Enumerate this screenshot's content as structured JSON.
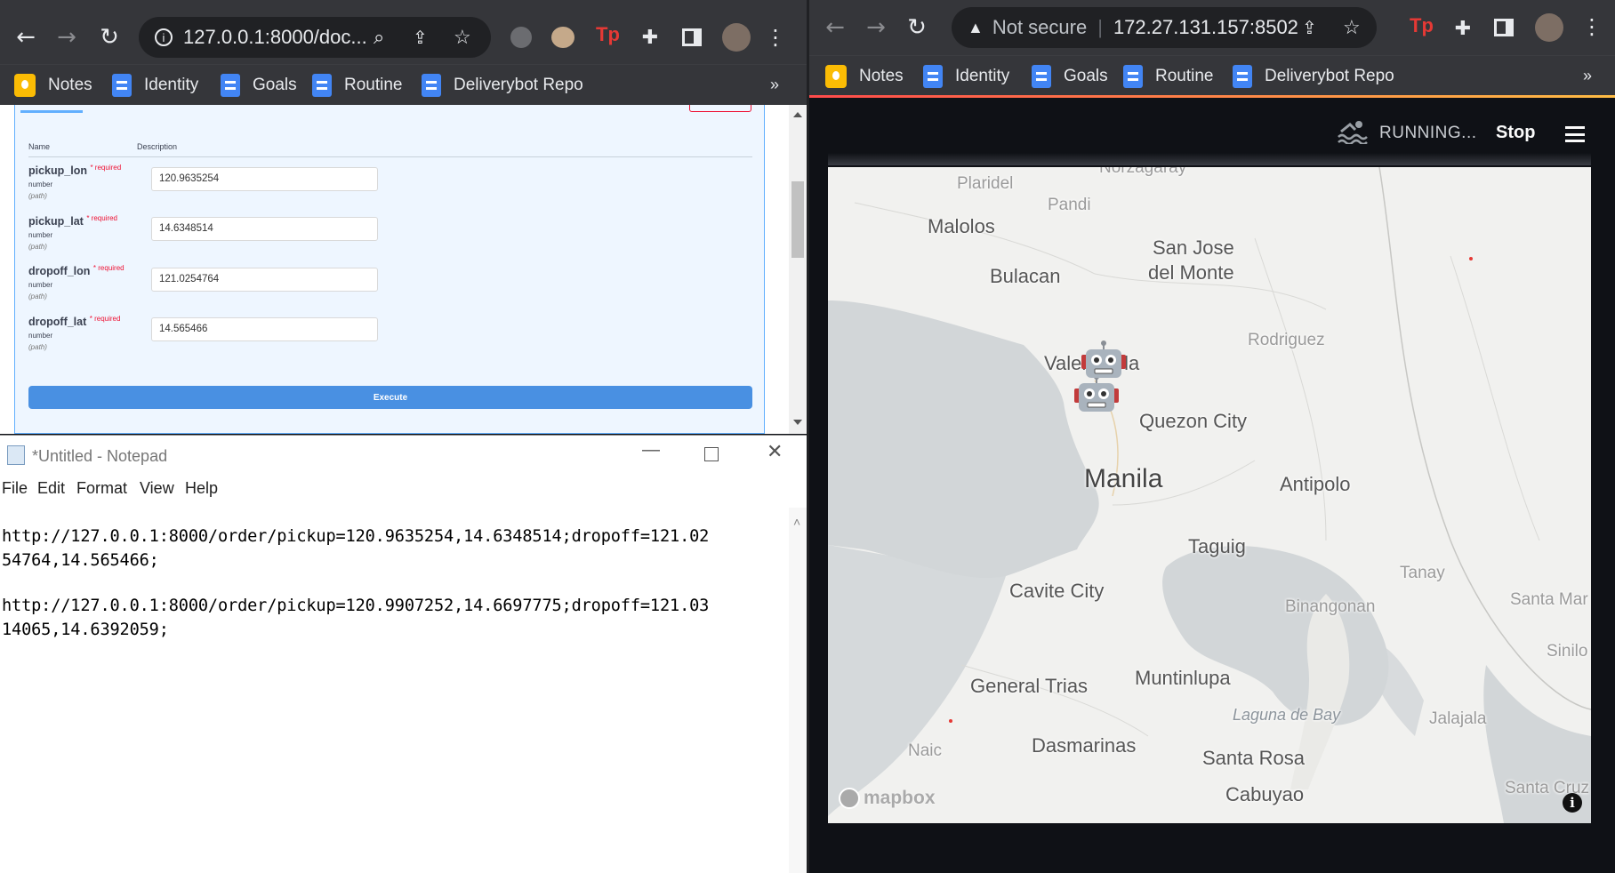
{
  "left_browser": {
    "url": "127.0.0.1:8000/doc...",
    "bookmarks": [
      "Notes",
      "Identity",
      "Goals",
      "Routine",
      "Deliverybot Repo"
    ],
    "more": "»",
    "params_header": {
      "name": "Name",
      "description": "Description"
    },
    "params": [
      {
        "name": "pickup_lon",
        "required": "* required",
        "type": "number",
        "location": "(path)",
        "value": "120.9635254"
      },
      {
        "name": "pickup_lat",
        "required": "* required",
        "type": "number",
        "location": "(path)",
        "value": "14.6348514"
      },
      {
        "name": "dropoff_lon",
        "required": "* required",
        "type": "number",
        "location": "(path)",
        "value": "121.0254764"
      },
      {
        "name": "dropoff_lat",
        "required": "* required",
        "type": "number",
        "location": "(path)",
        "value": "14.565466"
      }
    ],
    "execute_label": "Execute"
  },
  "notepad": {
    "title": "*Untitled - Notepad",
    "menu": [
      "File",
      "Edit",
      "Format",
      "View",
      "Help"
    ],
    "lines": [
      "http://127.0.0.1:8000/order/pickup=120.9635254,14.6348514;dropoff=121.02",
      "54764,14.565466;",
      "",
      "http://127.0.0.1:8000/order/pickup=120.9907252,14.6697775;dropoff=121.03",
      "14065,14.6392059;"
    ]
  },
  "right_browser": {
    "security": "Not secure",
    "url": "172.27.131.157:8502",
    "bookmarks": [
      "Notes",
      "Identity",
      "Goals",
      "Routine",
      "Deliverybot Repo"
    ],
    "more": "»",
    "status": "RUNNING...",
    "stop_label": "Stop",
    "map": {
      "attribution": "mapbox",
      "labels": {
        "norzagaray": "Norzagaray",
        "plaridel": "Plaridel",
        "pandi": "Pandi",
        "malolos": "Malolos",
        "san_jose_1": "San Jose",
        "san_jose_2": "del Monte",
        "bulacan": "Bulacan",
        "rodriguez": "Rodriguez",
        "valenzuela": "Valenzuela",
        "quezon": "Quezon City",
        "manila": "Manila",
        "antipolo": "Antipolo",
        "taguig": "Taguig",
        "tanay": "Tanay",
        "cavite": "Cavite City",
        "binangonan": "Binangonan",
        "santa_mar": "Santa Mar",
        "sinilo": "Sinilo",
        "general_trias": "General Trias",
        "muntinlupa": "Muntinlupa",
        "laguna_de_bay": "Laguna de Bay",
        "jalajala": "Jalajala",
        "naic": "Naic",
        "dasmarinas": "Dasmarinas",
        "santa_rosa": "Santa Rosa",
        "cabuyao": "Cabuyao",
        "santa_cruz": "Santa Cruz"
      }
    }
  }
}
